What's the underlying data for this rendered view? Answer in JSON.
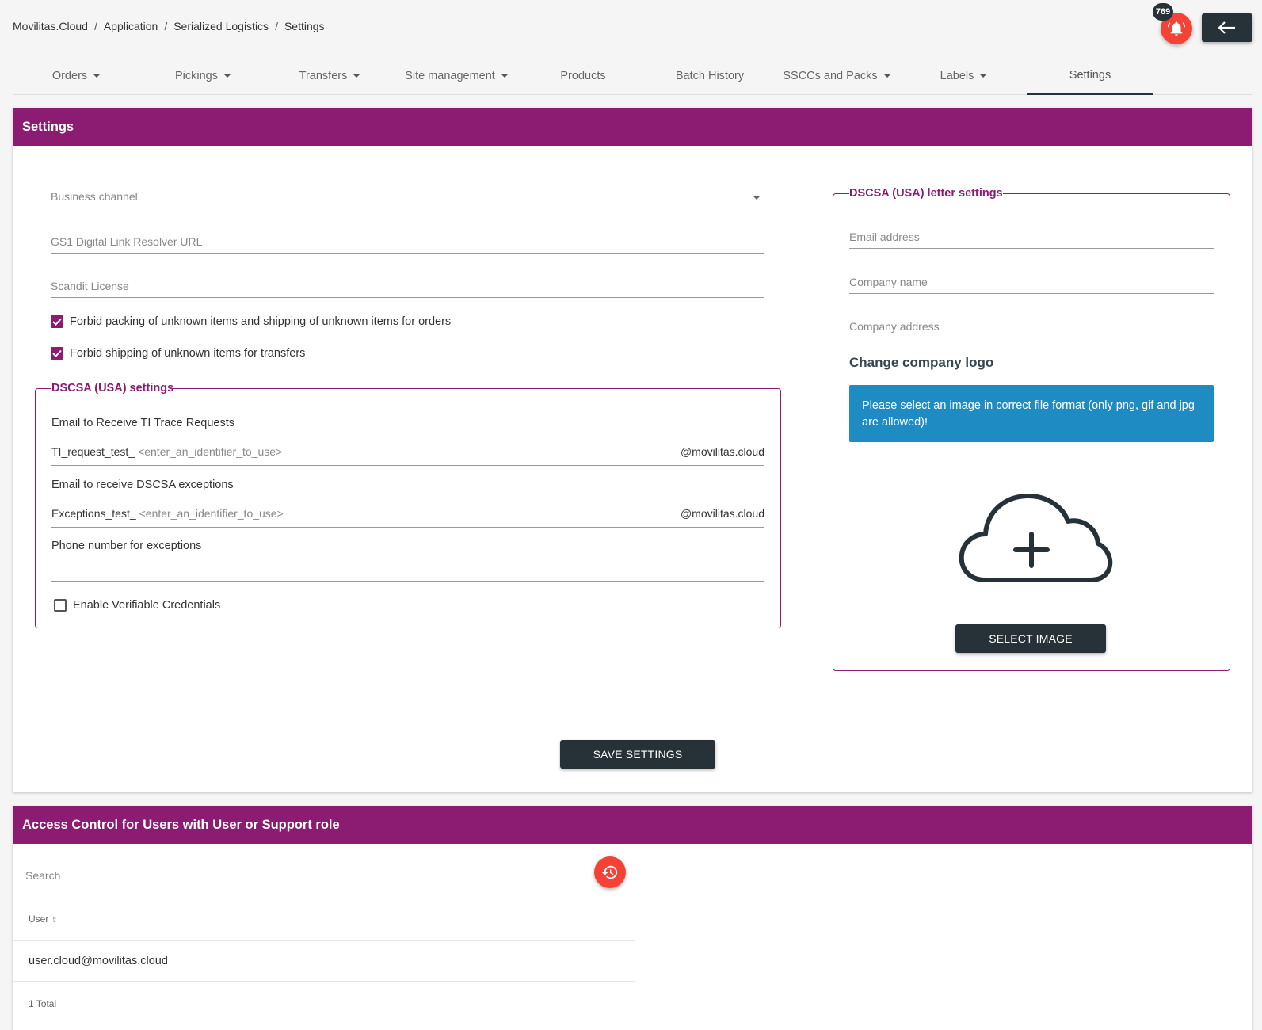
{
  "breadcrumb": [
    "Movilitas.Cloud",
    "Application",
    "Serialized Logistics",
    "Settings"
  ],
  "notifications": {
    "count": "769"
  },
  "tabs": [
    {
      "label": "Orders",
      "dropdown": true
    },
    {
      "label": "Pickings",
      "dropdown": true
    },
    {
      "label": "Transfers",
      "dropdown": true
    },
    {
      "label": "Site management",
      "dropdown": true
    },
    {
      "label": "Products",
      "dropdown": false
    },
    {
      "label": "Batch History",
      "dropdown": false
    },
    {
      "label": "SSCCs and Packs",
      "dropdown": true
    },
    {
      "label": "Labels",
      "dropdown": true
    },
    {
      "label": "Settings",
      "dropdown": false,
      "active": true
    }
  ],
  "settings": {
    "title": "Settings",
    "business_channel_placeholder": "Business channel",
    "gs1_placeholder": "GS1 Digital Link Resolver URL",
    "scandit_placeholder": "Scandit License",
    "forbid_orders_label": "Forbid packing of unknown items and shipping of unknown items for orders",
    "forbid_orders_checked": true,
    "forbid_transfers_label": "Forbid shipping of unknown items for transfers",
    "forbid_transfers_checked": true,
    "dscsa": {
      "legend": "DSCSA (USA) settings",
      "ti_label": "Email to Receive TI Trace Requests",
      "ti_prefix": "TI_request_test_",
      "ti_placeholder": "<enter_an_identifier_to_use>",
      "ti_domain": "@movilitas.cloud",
      "exceptions_label": "Email to receive DSCSA exceptions",
      "exceptions_prefix": "Exceptions_test_",
      "exceptions_placeholder": "<enter_an_identifier_to_use>",
      "exceptions_domain": "@movilitas.cloud",
      "phone_label": "Phone number for exceptions",
      "vc_label": "Enable Verifiable Credentials",
      "vc_checked": false
    },
    "letter": {
      "legend": "DSCSA (USA) letter settings",
      "email_placeholder": "Email address",
      "company_name_placeholder": "Company name",
      "company_address_placeholder": "Company address",
      "logo_heading": "Change company logo",
      "info": "Please select an image in correct file format (only png, gif and jpg are allowed)!",
      "select_image": "SELECT IMAGE"
    },
    "save_button": "SAVE SETTINGS"
  },
  "access": {
    "title": "Access Control for Users with User or Support role",
    "search_placeholder": "Search",
    "column_user": "User",
    "rows": [
      "user.cloud@movilitas.cloud"
    ],
    "total": "1 Total"
  },
  "colors": {
    "primary": "#8b1c72",
    "dark": "#263238",
    "danger": "#f44336",
    "info": "#1e8bc3"
  }
}
